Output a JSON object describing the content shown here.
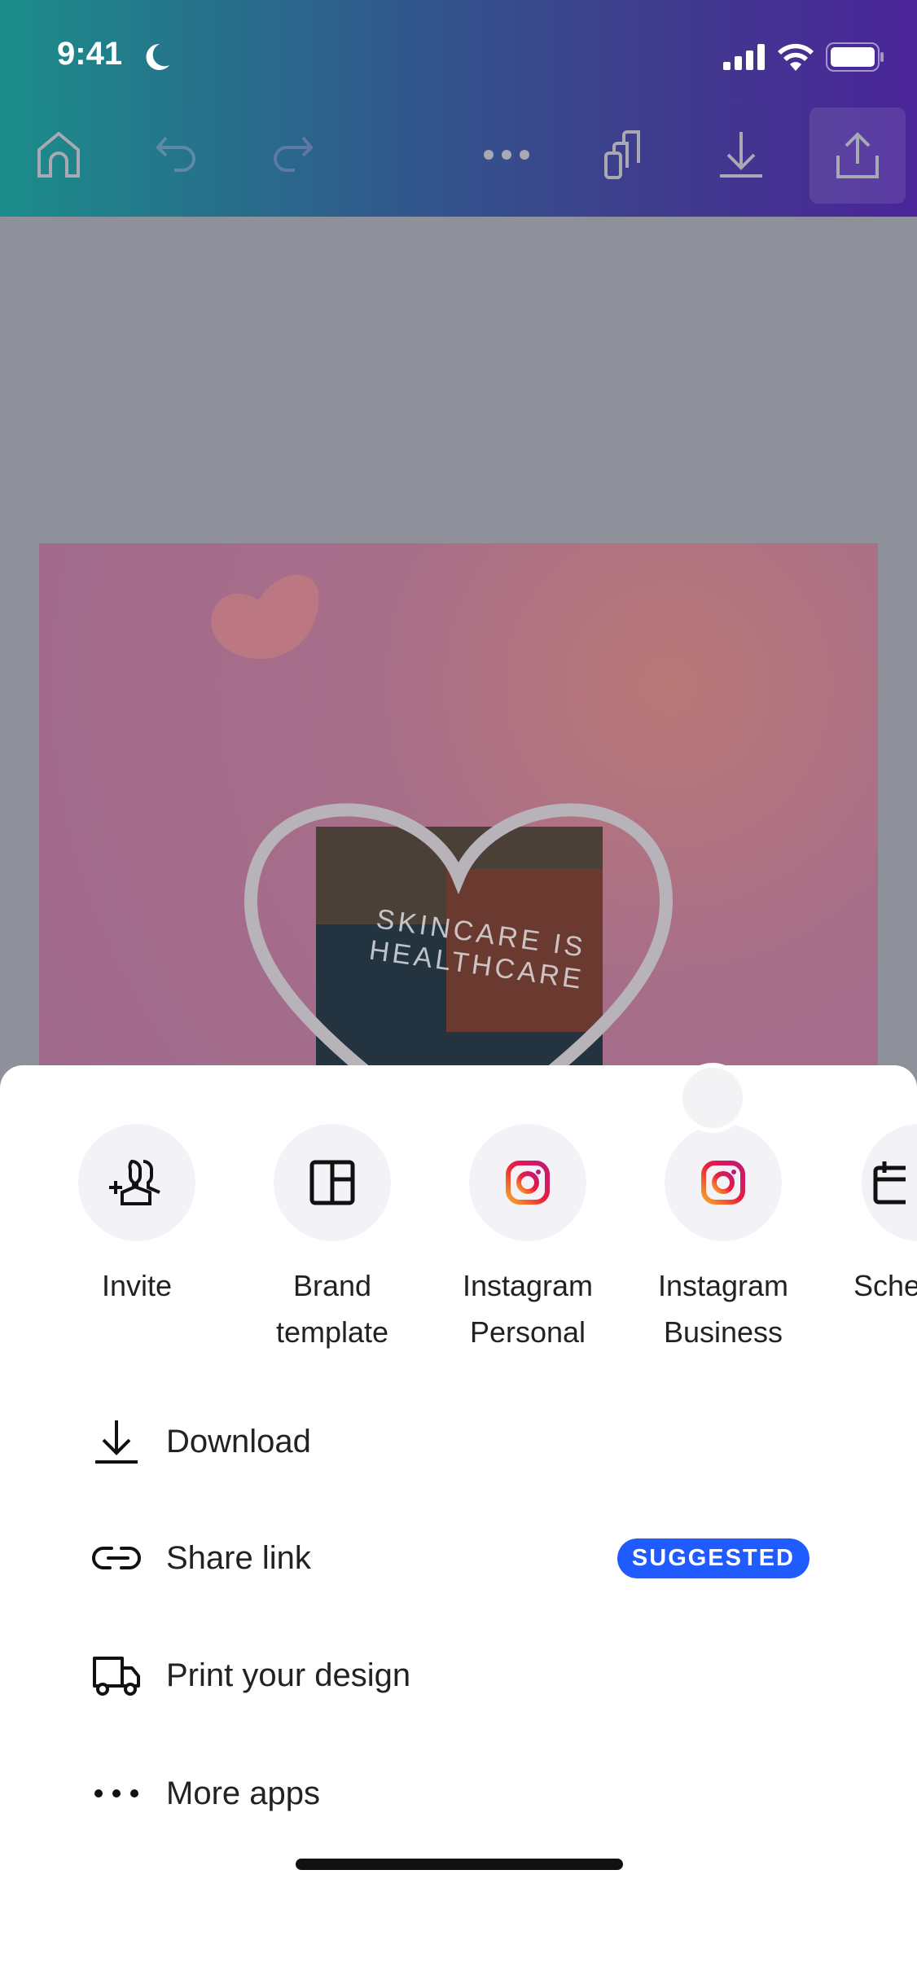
{
  "status_bar": {
    "time": "9:41"
  },
  "toolbar": {
    "icons": [
      "home-icon",
      "undo-icon",
      "redo-icon",
      "more-icon",
      "pages-icon",
      "download-icon",
      "share-icon"
    ]
  },
  "design": {
    "curved_text": "SKINCARE IS HEALTHCARE"
  },
  "share_sheet": {
    "apps": [
      {
        "label": "Invite",
        "icon": "invite-people-icon"
      },
      {
        "label": "Brand template",
        "icon": "brand-template-icon"
      },
      {
        "label": "Instagram Personal",
        "icon": "instagram-icon"
      },
      {
        "label": "Instagram Business",
        "icon": "instagram-icon"
      },
      {
        "label": "Sche",
        "icon": "calendar-icon"
      }
    ],
    "actions": [
      {
        "label": "Download",
        "icon": "download-icon"
      },
      {
        "label": "Share link",
        "icon": "link-icon",
        "badge": "SUGGESTED"
      },
      {
        "label": "Print your design",
        "icon": "truck-icon"
      },
      {
        "label": "More apps",
        "icon": "more-icon"
      }
    ]
  },
  "colors": {
    "badge": "#1f5bff",
    "header_start": "#1b8d8a",
    "header_end": "#4b2599"
  }
}
